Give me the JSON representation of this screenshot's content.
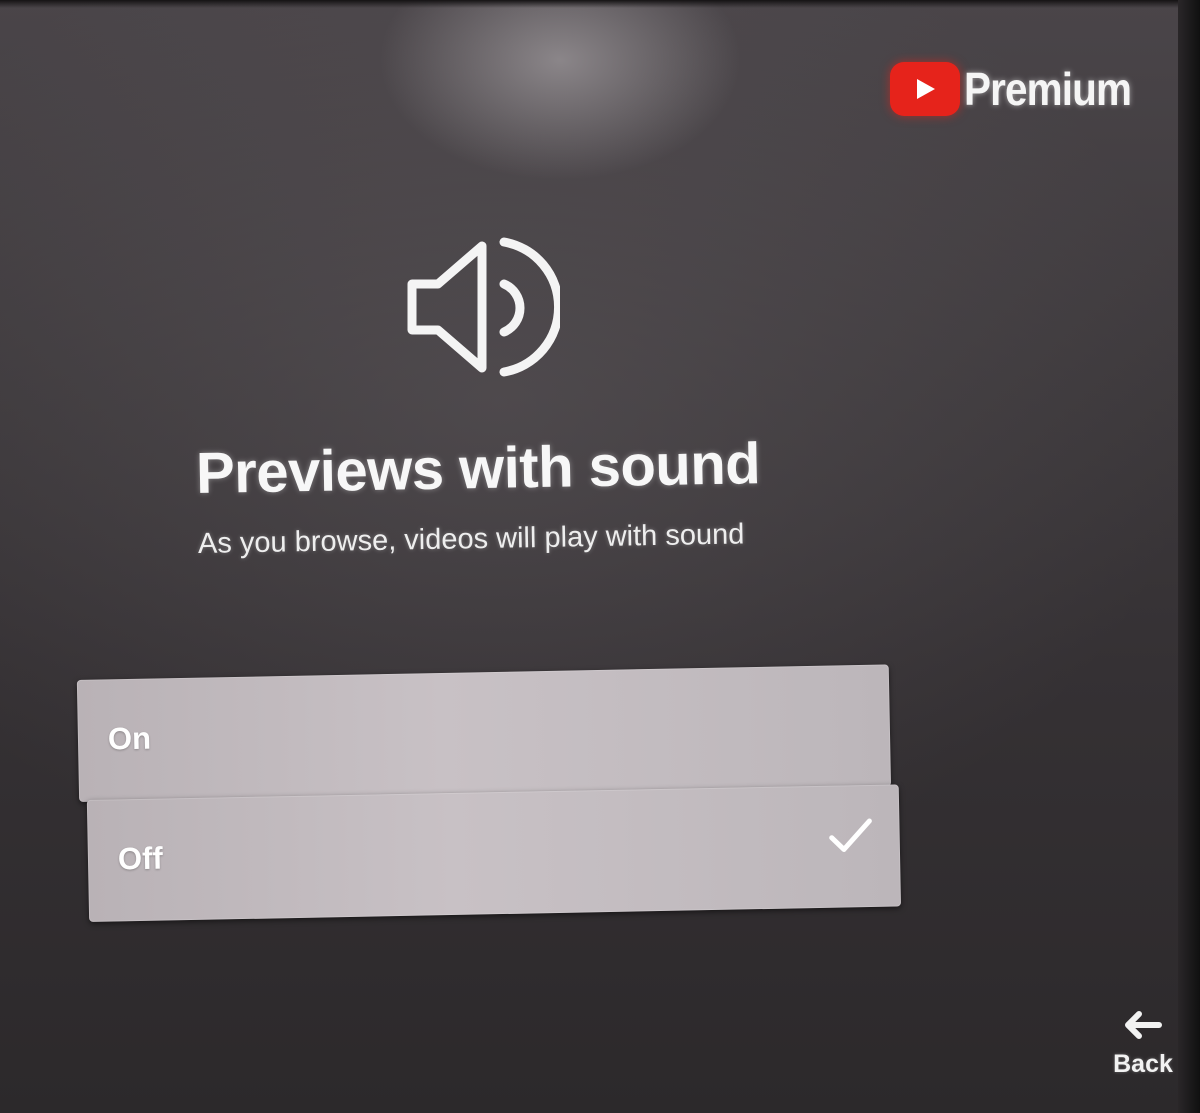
{
  "brand": {
    "name": "Premium",
    "logo_icon": "youtube-play-icon",
    "logo_color": "#e6231b"
  },
  "hero": {
    "icon": "speaker-volume-icon",
    "title": "Previews with sound",
    "subtitle": "As you browse, videos will play with sound"
  },
  "options": [
    {
      "label": "On",
      "selected": false
    },
    {
      "label": "Off",
      "selected": true,
      "indicator_icon": "checkmark-icon"
    }
  ],
  "footer": {
    "back_label": "Back",
    "back_icon": "arrow-left-icon"
  }
}
